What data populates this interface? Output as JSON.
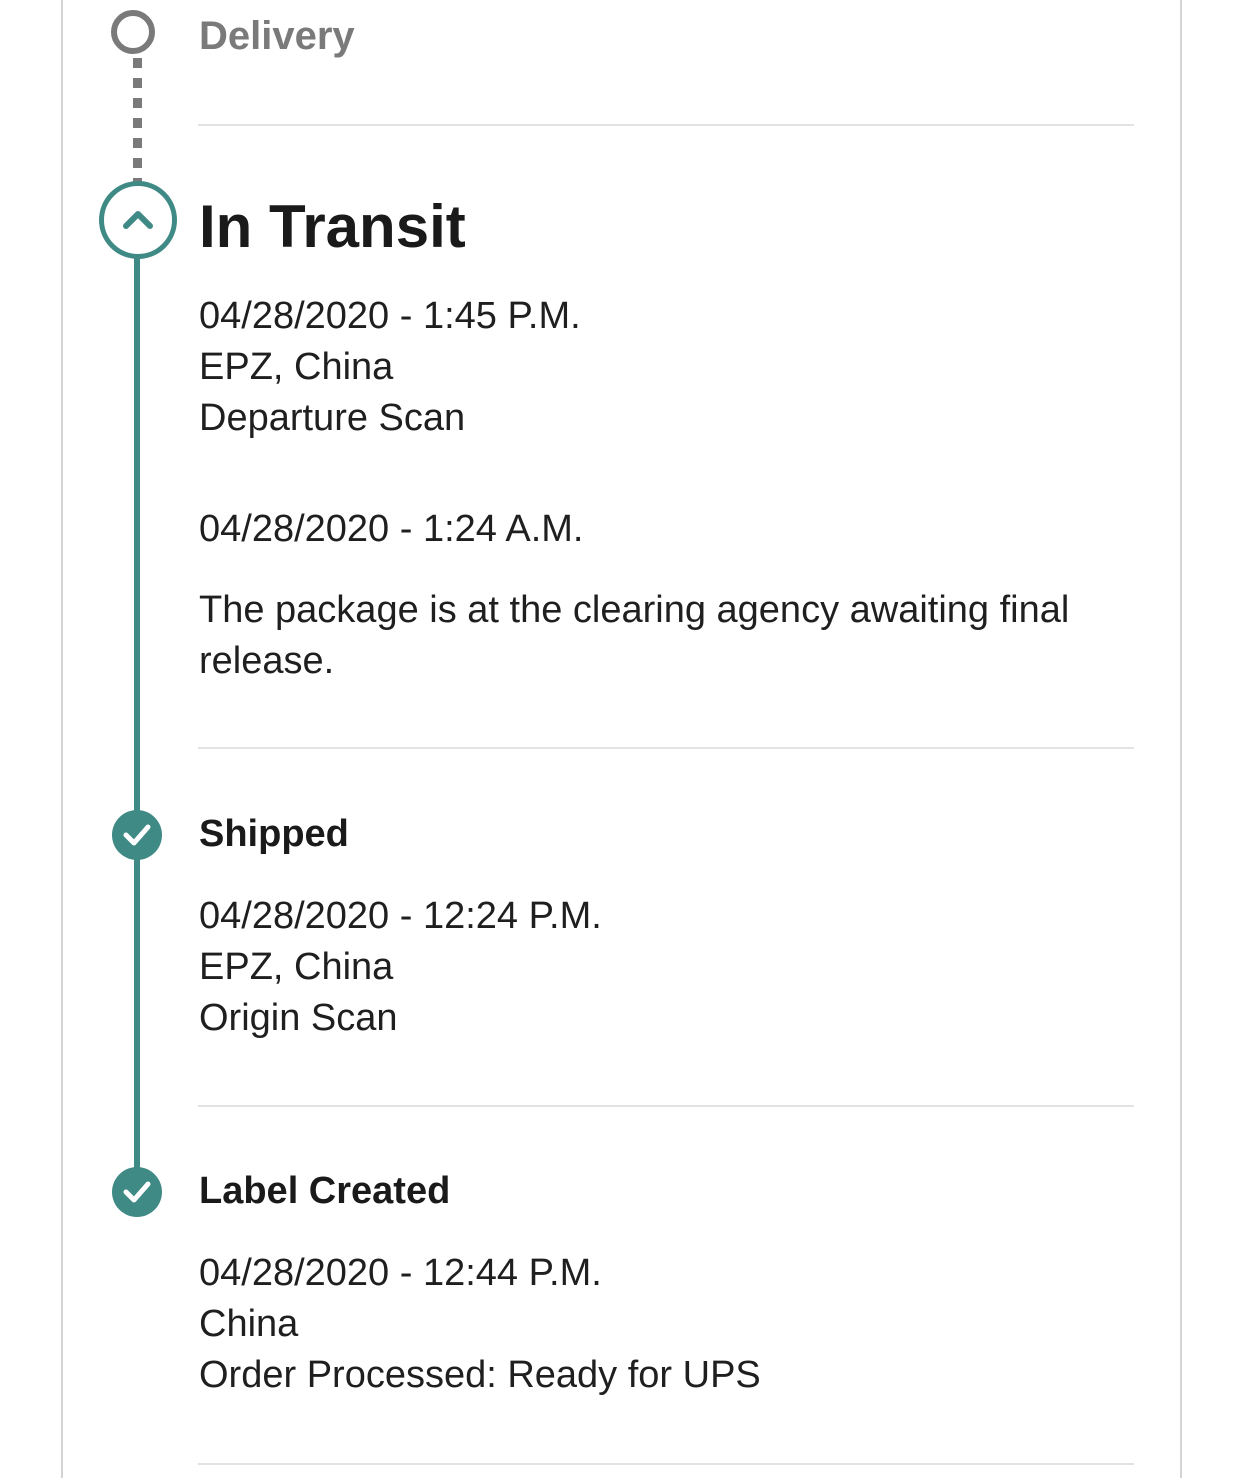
{
  "timeline": {
    "delivery": {
      "label": "Delivery"
    },
    "in_transit": {
      "title": "In Transit",
      "events": [
        {
          "datetime": "04/28/2020 - 1:45 P.M.",
          "location": "EPZ, China",
          "activity": "Departure Scan"
        },
        {
          "datetime": "04/28/2020 - 1:24 A.M.",
          "activity": "The package is at the clearing agency awaiting final release."
        }
      ]
    },
    "shipped": {
      "title": "Shipped",
      "events": [
        {
          "datetime": "04/28/2020 - 12:24 P.M.",
          "location": "EPZ, China",
          "activity": "Origin Scan"
        }
      ]
    },
    "label_created": {
      "title": "Label Created",
      "events": [
        {
          "datetime": "04/28/2020 - 12:44 P.M.",
          "location": "China",
          "activity": "Order Processed: Ready for UPS"
        }
      ]
    }
  },
  "colors": {
    "accent": "#3f8a84",
    "pending": "#7a7a7a",
    "divider": "#e3e3e3"
  },
  "icons": {
    "current": "chevron-up-icon",
    "done": "check-icon",
    "pending": "empty-circle-icon"
  }
}
